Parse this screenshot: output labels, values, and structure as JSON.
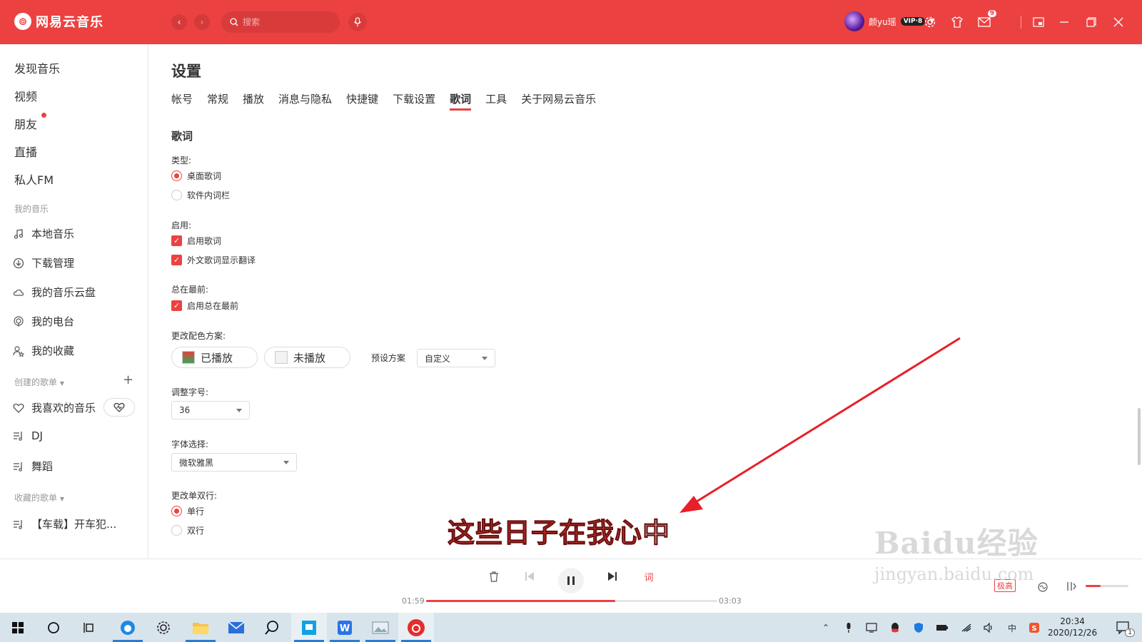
{
  "app": {
    "name": "网易云音乐"
  },
  "header": {
    "search_placeholder": "搜索",
    "username": "颜yu瑶",
    "vip": "VIP·8",
    "mail_count": "9"
  },
  "sidebar": {
    "top_items": [
      "发现音乐",
      "视频",
      "朋友",
      "直播",
      "私人FM"
    ],
    "my_music_title": "我的音乐",
    "my_music": [
      "本地音乐",
      "下载管理",
      "我的音乐云盘",
      "我的电台",
      "我的收藏"
    ],
    "created_title": "创建的歌单",
    "created": [
      "我喜欢的音乐",
      "DJ",
      "舞蹈"
    ],
    "collected_title": "收藏的歌单",
    "collected": [
      "【车载】开车犯..."
    ]
  },
  "settings": {
    "title": "设置",
    "tabs": [
      "帐号",
      "常规",
      "播放",
      "消息与隐私",
      "快捷键",
      "下载设置",
      "歌词",
      "工具",
      "关于网易云音乐"
    ],
    "active_tab": "歌词",
    "section": "歌词",
    "type_label": "类型:",
    "type_options": [
      "桌面歌词",
      "软件内词栏"
    ],
    "enable_label": "启用:",
    "enable_options": [
      "启用歌词",
      "外文歌词显示翻译"
    ],
    "ontop_label": "总在最前:",
    "ontop_option": "启用总在最前",
    "color_label": "更改配色方案:",
    "played_label": "已播放",
    "unplayed_label": "未播放",
    "preset_label": "预设方案",
    "preset_value": "自定义",
    "fontsize_label": "调整字号:",
    "fontsize_value": "36",
    "font_label": "字体选择:",
    "font_value": "微软雅黑",
    "lines_label": "更改单双行:",
    "lines_options": [
      "单行",
      "双行"
    ]
  },
  "lyric": {
    "played": "这些日子在我心",
    "unplayed": "中"
  },
  "player": {
    "current_time": "01:59",
    "total_time": "03:03",
    "progress": 0.65,
    "quality": "极高",
    "lyric_btn": "词",
    "volume": 0.35
  },
  "taskbar": {
    "time": "20:34",
    "date": "2020/12/26",
    "ime": "中",
    "notifications": "1"
  },
  "watermark": {
    "main": "Baidu经验",
    "sub": "jingyan.baidu.com"
  },
  "colors": {
    "brand": "#ec4141",
    "taskbar": "#d8e4ec"
  }
}
